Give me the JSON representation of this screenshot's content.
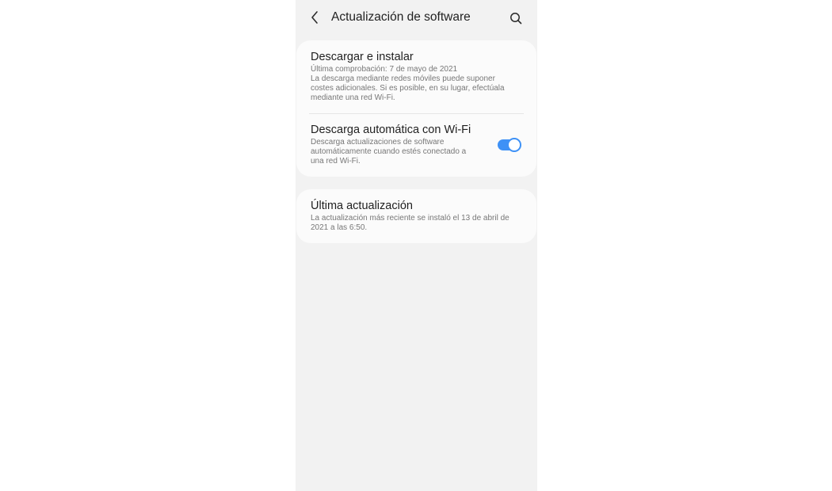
{
  "header": {
    "title": "Actualización de software",
    "back_icon": "chevron-left-icon",
    "search_icon": "search-icon"
  },
  "download_card": {
    "item_download": {
      "title": "Descargar e instalar",
      "subtitle_lines": [
        "Última comprobación: 7 de mayo de 2021",
        "La descarga mediante redes móviles puede suponer",
        "costes adicionales. Si es posible, en su lugar, efectúala",
        "mediante una red Wi-Fi."
      ]
    },
    "item_auto_wifi": {
      "title": "Descarga automática con Wi-Fi",
      "subtitle_lines": [
        "Descarga actualizaciones de software",
        "automáticamente cuando estés conectado a",
        "una red Wi-Fi."
      ],
      "toggle_on": true
    }
  },
  "last_update_card": {
    "title": "Última actualización",
    "subtitle_lines": [
      "La actualización más reciente se instaló el 13 de abril de",
      "2021 a las 6:50."
    ]
  },
  "colors": {
    "accent": "#3e91f6",
    "background": "#f2f2f2",
    "card": "#fbfbfb"
  }
}
